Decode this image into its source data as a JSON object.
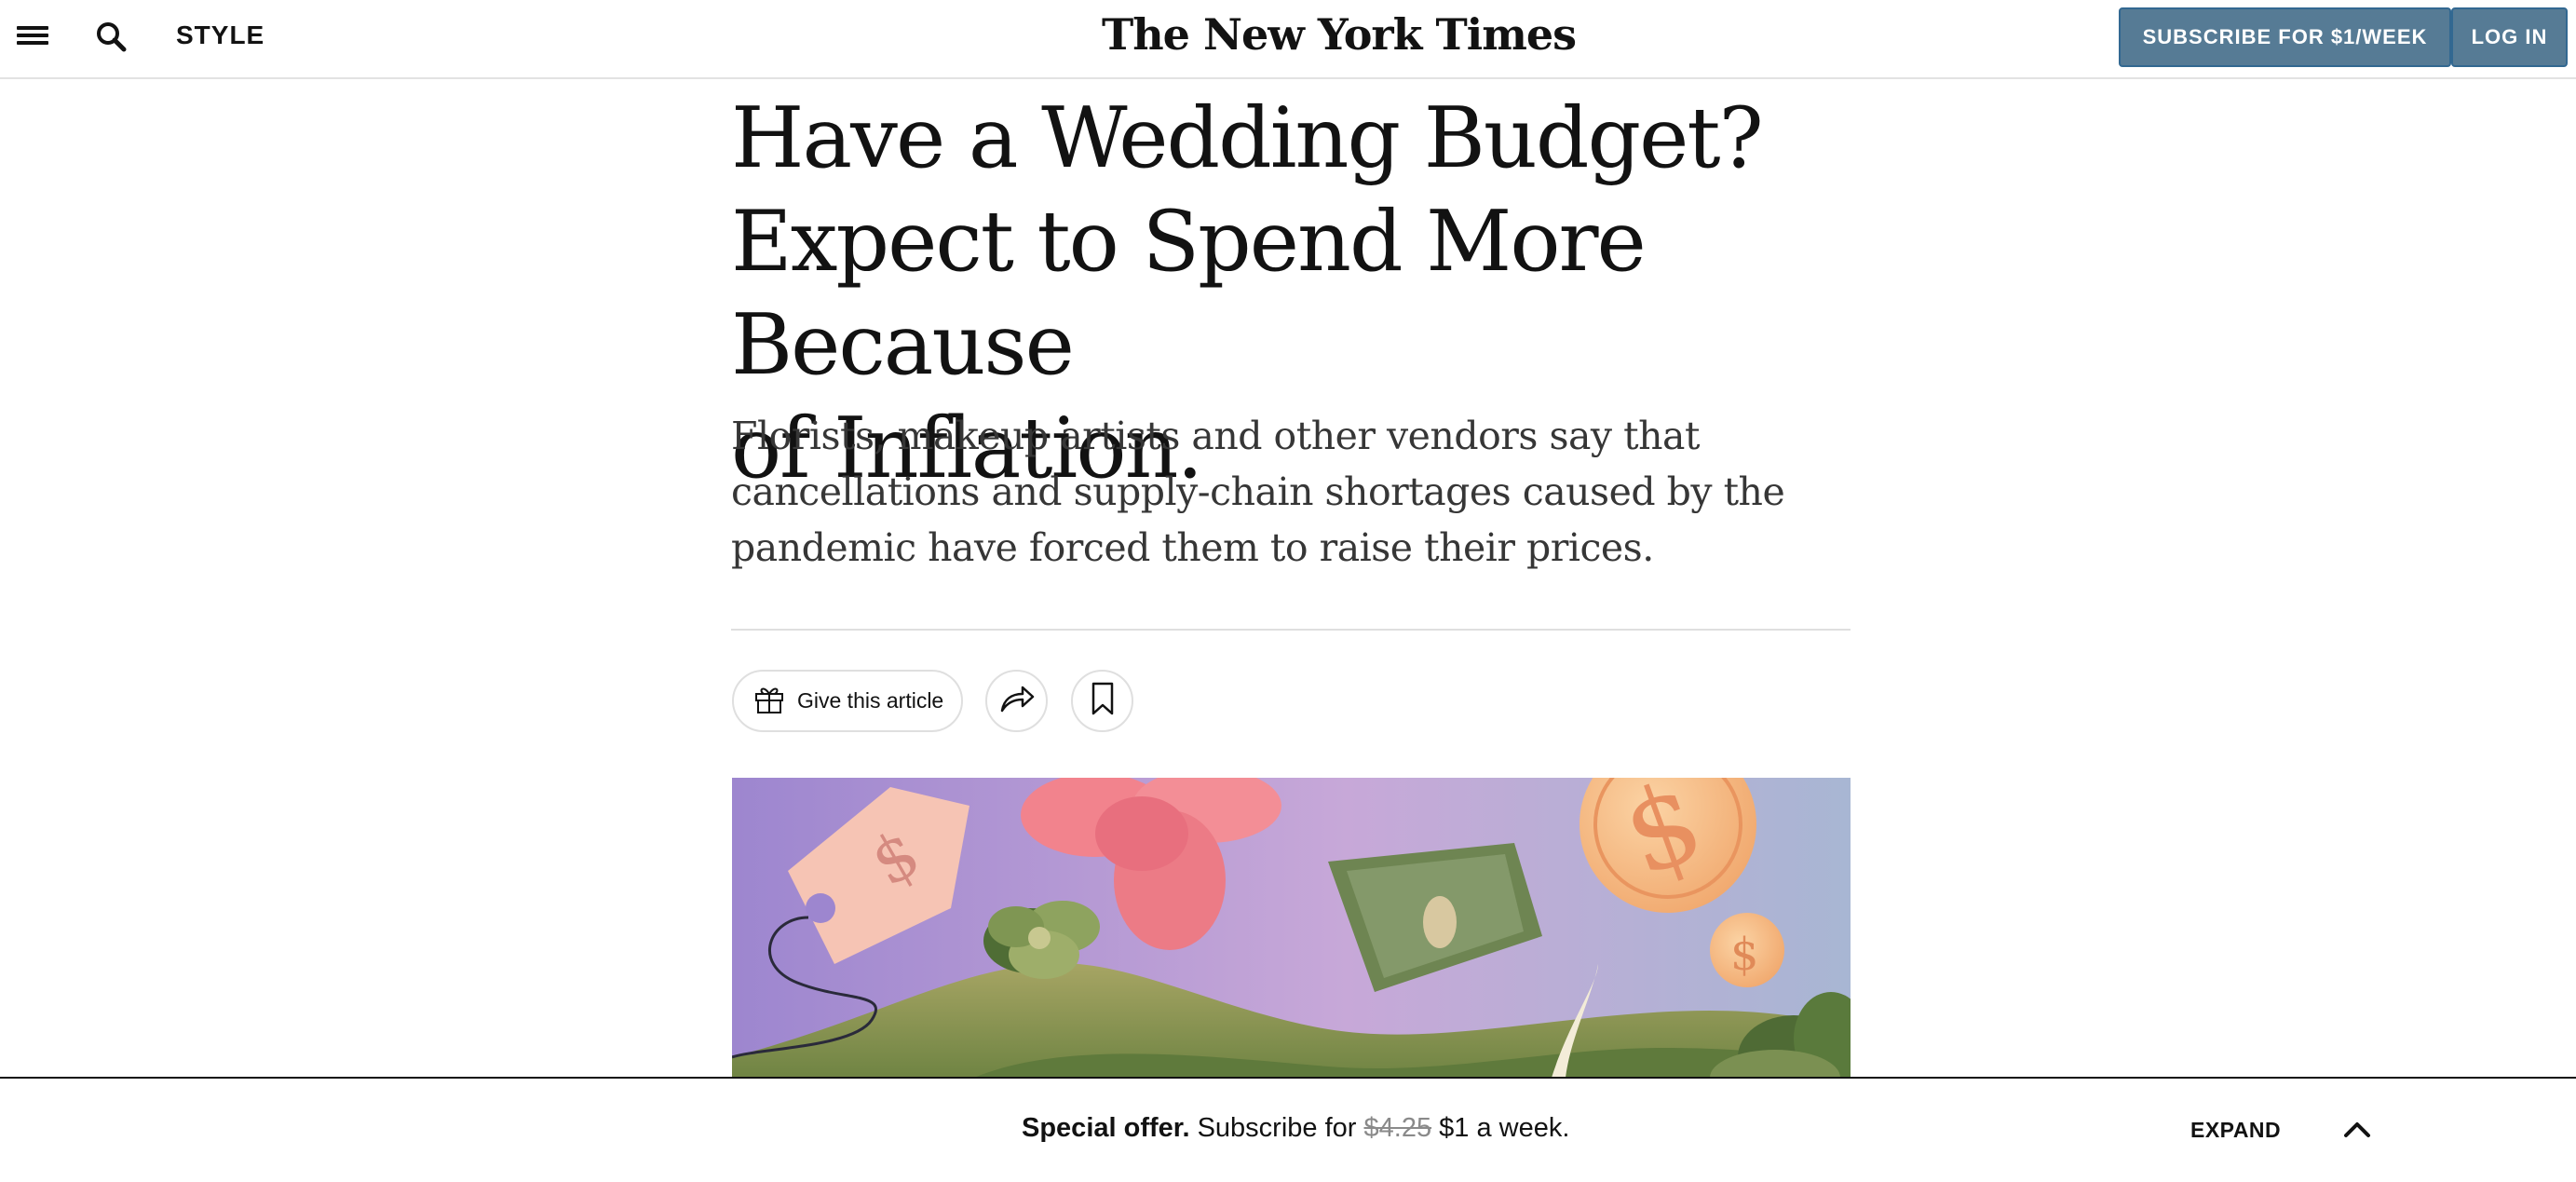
{
  "header": {
    "section": "STYLE",
    "masthead": "The New York Times",
    "subscribe_label": "SUBSCRIBE FOR $1/WEEK",
    "login_label": "LOG IN",
    "icons": {
      "menu": "menu-icon",
      "search": "search-icon"
    }
  },
  "article": {
    "headline_lines": [
      "Have a Wedding Budget?",
      "Expect to Spend More Because",
      "of Inflation."
    ],
    "summary": "Florists, makeup artists and other vendors say that cancellations and supply-chain shortages caused by the pandemic have forced them to raise their prices.",
    "actions": {
      "gift_label": "Give this article",
      "icons": {
        "gift": "gift-icon",
        "share": "share-icon",
        "save": "bookmark-icon"
      }
    }
  },
  "offer_bar": {
    "lead": "Special offer.",
    "text_before": " Subscribe for ",
    "old_price": "$4.25",
    "text_after": " $1 a week.",
    "expand_label": "EXPAND",
    "icon": "chevron-up-icon"
  },
  "colors": {
    "accent": "#567b95",
    "text": "#121212",
    "rule": "#dfdfdf"
  }
}
